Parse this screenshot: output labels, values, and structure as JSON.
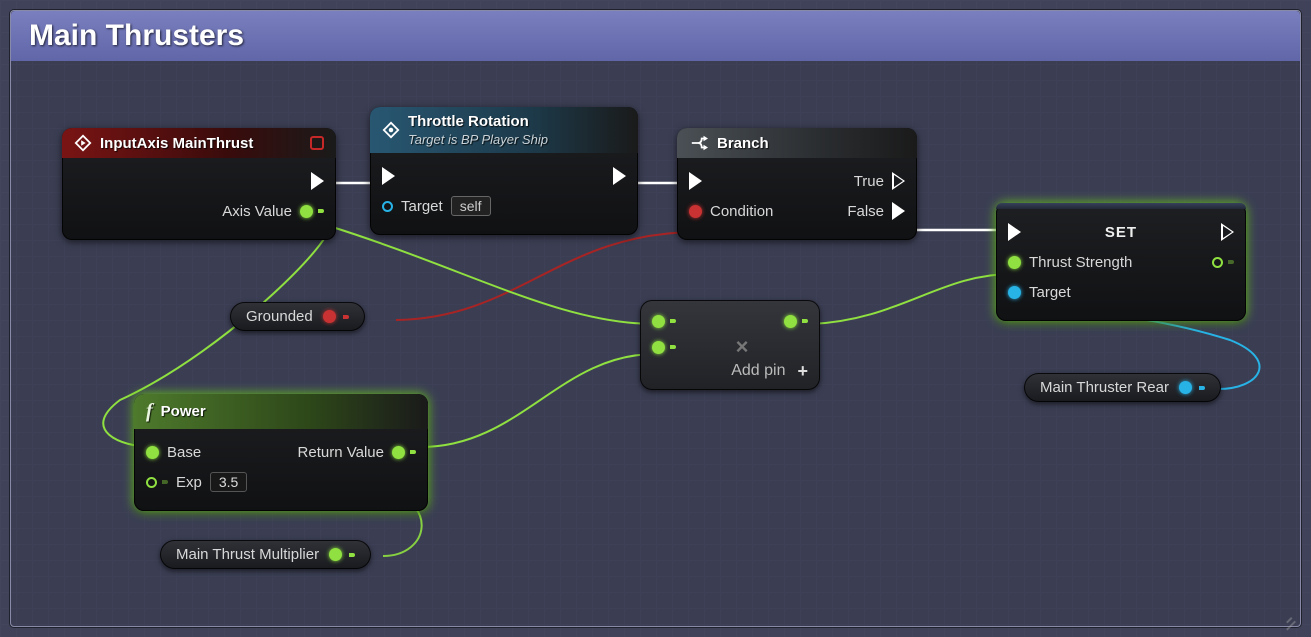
{
  "comment": {
    "title": "Main Thrusters"
  },
  "nodes": {
    "input_axis": {
      "title": "InputAxis MainThrust",
      "axis_value_label": "Axis Value"
    },
    "throttle": {
      "title": "Throttle Rotation",
      "subtitle": "Target is BP Player Ship",
      "target_label": "Target",
      "target_value": "self"
    },
    "branch": {
      "title": "Branch",
      "condition_label": "Condition",
      "true_label": "True",
      "false_label": "False"
    },
    "set": {
      "title": "SET",
      "thrust_label": "Thrust Strength",
      "target_label": "Target"
    },
    "power": {
      "title": "Power",
      "base_label": "Base",
      "exp_label": "Exp",
      "exp_value": "3.5",
      "return_label": "Return Value"
    },
    "multiply": {
      "add_pin_label": "Add pin"
    }
  },
  "vars": {
    "grounded": "Grounded",
    "thrust_mult": "Main Thrust Multiplier",
    "thruster_rear": "Main Thruster Rear"
  }
}
